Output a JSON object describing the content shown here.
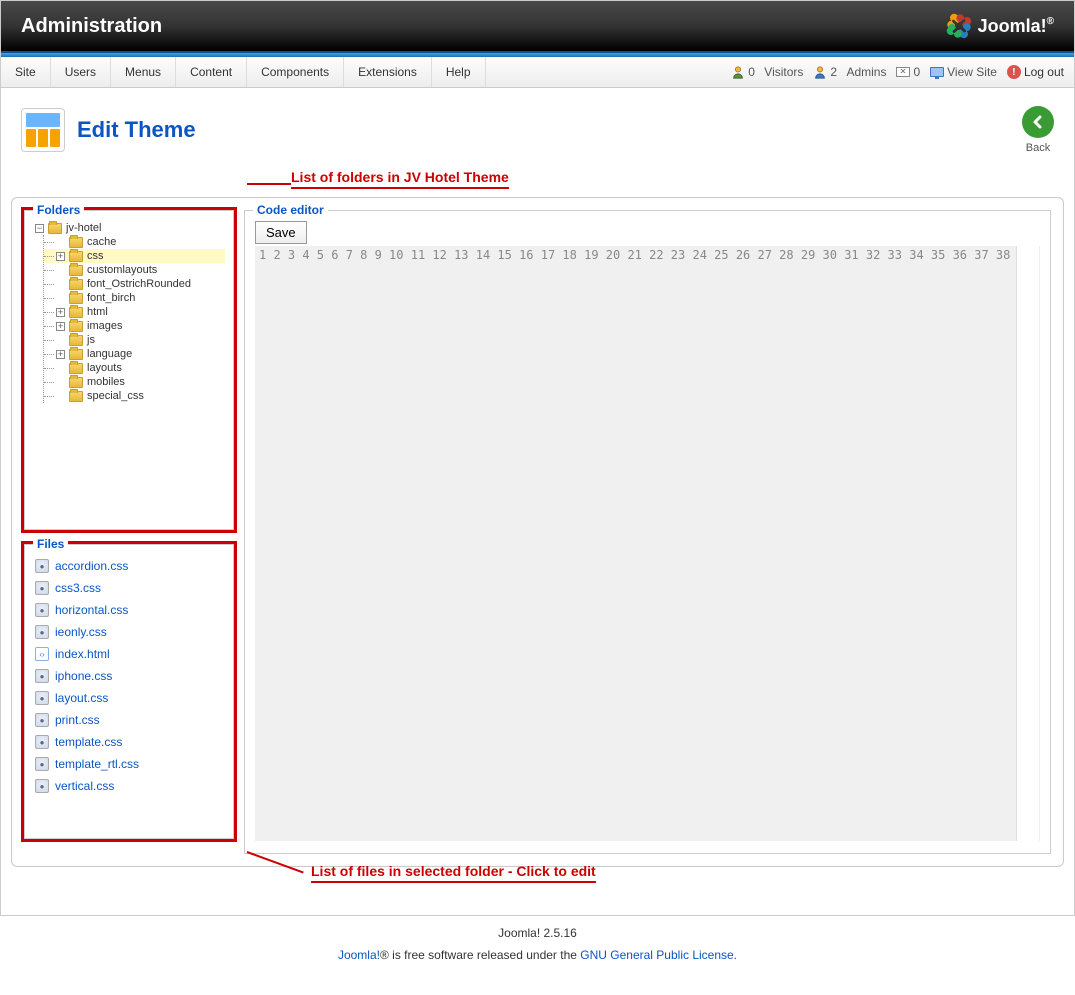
{
  "header": {
    "title": "Administration",
    "brand": "Joomla!"
  },
  "menubar": {
    "items": [
      "Site",
      "Users",
      "Menus",
      "Content",
      "Components",
      "Extensions",
      "Help"
    ],
    "stats": {
      "visitors_count": "0",
      "visitors_label": "Visitors",
      "admins_count": "2",
      "admins_label": "Admins",
      "messages_count": "0",
      "view_site": "View Site",
      "logout": "Log out"
    }
  },
  "page": {
    "title": "Edit Theme",
    "back_label": "Back"
  },
  "annotations": {
    "top": "List of folders in JV Hotel Theme",
    "bottom": "List of files in selected folder - Click to edit"
  },
  "panels": {
    "folders": "Folders",
    "files": "Files",
    "editor": "Code editor",
    "save": "Save"
  },
  "tree": {
    "root": {
      "label": "jv-hotel",
      "expanded": true,
      "toggle": "−"
    },
    "children": [
      {
        "label": "cache",
        "toggle": ""
      },
      {
        "label": "css",
        "toggle": "+",
        "selected": true
      },
      {
        "label": "customlayouts",
        "toggle": ""
      },
      {
        "label": "font_OstrichRounded",
        "toggle": ""
      },
      {
        "label": "font_birch",
        "toggle": ""
      },
      {
        "label": "html",
        "toggle": "+"
      },
      {
        "label": "images",
        "toggle": "+"
      },
      {
        "label": "js",
        "toggle": ""
      },
      {
        "label": "language",
        "toggle": "+"
      },
      {
        "label": "layouts",
        "toggle": ""
      },
      {
        "label": "mobiles",
        "toggle": ""
      },
      {
        "label": "special_css",
        "toggle": ""
      }
    ]
  },
  "files": [
    {
      "name": "accordion.css",
      "type": "css"
    },
    {
      "name": "css3.css",
      "type": "css"
    },
    {
      "name": "horizontal.css",
      "type": "css"
    },
    {
      "name": "ieonly.css",
      "type": "css"
    },
    {
      "name": "index.html",
      "type": "html"
    },
    {
      "name": "iphone.css",
      "type": "css"
    },
    {
      "name": "layout.css",
      "type": "css"
    },
    {
      "name": "print.css",
      "type": "css"
    },
    {
      "name": "template.css",
      "type": "css"
    },
    {
      "name": "template_rtl.css",
      "type": "css"
    },
    {
      "name": "vertical.css",
      "type": "css"
    }
  ],
  "editor": {
    "line_count": 38
  },
  "footer": {
    "version": "Joomla! 2.5.16",
    "line2_prefix": "Joomla!® ",
    "line2_mid": "is free software released under the ",
    "license": "GNU General Public License.",
    "brand_link": "Joomla!"
  }
}
